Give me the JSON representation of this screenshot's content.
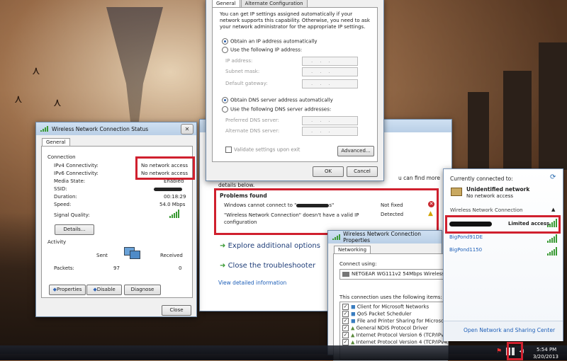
{
  "status_window": {
    "title": "Wireless Network Connection Status",
    "tab": "General",
    "connection_header": "Connection",
    "rows": [
      {
        "label": "IPv4 Connectivity:",
        "value": "No network access"
      },
      {
        "label": "IPv6 Connectivity:",
        "value": "No network access"
      },
      {
        "label": "Media State:",
        "value": "Enabled"
      },
      {
        "label": "SSID:",
        "value": ""
      },
      {
        "label": "Duration:",
        "value": "00:18:29"
      },
      {
        "label": "Speed:",
        "value": "54.0 Mbps"
      }
    ],
    "signal_label": "Signal Quality:",
    "details_button": "Details...",
    "activity_header": "Activity",
    "sent_label": "Sent",
    "received_label": "Received",
    "packets_label": "Packets:",
    "packets_sent": "97",
    "packets_received": "0",
    "properties_button": "Properties",
    "disable_button": "Disable",
    "diagnose_button": "Diagnose",
    "close_button": "Close"
  },
  "ip_window": {
    "tab_general": "General",
    "tab_alternate": "Alternate Configuration",
    "description": "You can get IP settings assigned automatically if your network supports this capability. Otherwise, you need to ask your network administrator for the appropriate IP settings.",
    "obtain_ip_auto": "Obtain an IP address automatically",
    "use_following_ip": "Use the following IP address:",
    "ip_address_label": "IP address:",
    "subnet_label": "Subnet mask:",
    "gateway_label": "Default gateway:",
    "obtain_dns_auto": "Obtain DNS server address automatically",
    "use_following_dns": "Use the following DNS server addresses:",
    "preferred_dns_label": "Preferred DNS server:",
    "alternate_dns_label": "Alternate DNS server:",
    "validate_label": "Validate settings upon exit",
    "advanced_button": "Advanced...",
    "ok_button": "OK",
    "cancel_button": "Cancel",
    "ip_dots": "..."
  },
  "troubleshooter": {
    "partial_right": "u can find more",
    "details_below": "details below.",
    "problems_found": "Problems found",
    "problems": [
      {
        "text": "Windows cannot connect to \"",
        "suffix": "s\"",
        "status": "Not fixed"
      },
      {
        "text": "\"Wireless Network Connection\" doesn't have a valid IP configuration",
        "suffix": "",
        "status": "Detected"
      }
    ],
    "explore_link": "Explore additional options",
    "close_link": "Close the troubleshooter",
    "view_detailed": "View detailed information"
  },
  "props_window": {
    "title": "Wireless Network Connection Properties",
    "tab": "Networking",
    "connect_using": "Connect using:",
    "adapter": "NETGEAR WG111v2 54Mbps Wireless US",
    "items_header": "This connection uses the following items:",
    "items": [
      "Client for Microsoft Networks",
      "QoS Packet Scheduler",
      "File and Printer Sharing for Microsoft Netw",
      "General NDIS Protocol Driver",
      "Internet Protocol Version 6 (TCP/IPv6)",
      "Internet Protocol Version 4 (TCP/IPv4)"
    ]
  },
  "network_flyout": {
    "currently_connected": "Currently connected to:",
    "network_name": "Unidentified network",
    "network_status": "No network access",
    "section": "Wireless Network Connection",
    "limited_access": "Limited access",
    "networks": [
      "BigPond91DE",
      "BigPond1150"
    ],
    "open_center": "Open Network and Sharing Center"
  },
  "taskbar": {
    "time": "5:54 PM",
    "date": "3/20/2013"
  },
  "colors": {
    "highlight_red": "#d0202e",
    "link_blue": "#1e3d78",
    "signal_green": "#3a9a34"
  }
}
